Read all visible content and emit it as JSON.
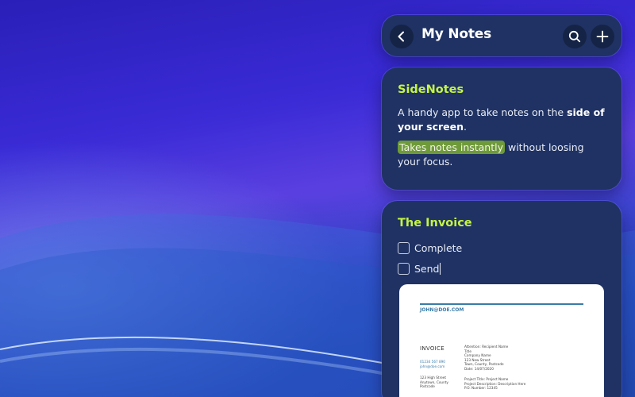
{
  "header": {
    "title": "My Notes"
  },
  "icons": {
    "back": "chevron-left-icon",
    "search": "search-icon",
    "add": "plus-icon"
  },
  "colors": {
    "card_bg": "#1f3263",
    "title_accent": "#c4f542",
    "highlight": "#6f9a3a"
  },
  "notes": [
    {
      "title": "SideNotes",
      "text_before": "A handy app to take notes on the ",
      "text_bold": "side of your screen",
      "text_after": ".",
      "highlighted": "Takes notes instantly",
      "rest": " without loosing your focus."
    },
    {
      "title": "The Invoice",
      "tasks": [
        {
          "label": "Complete",
          "checked": false
        },
        {
          "label": "Send",
          "checked": false
        }
      ],
      "attachment": {
        "email": "JOHN@DOE.COM",
        "heading": "INVOICE",
        "contact": [
          "01234 567 890",
          "john@doe.com"
        ],
        "address": [
          "123 High Street",
          "Anytown, County",
          "Postcode"
        ],
        "recipient": [
          "Attention: Recipient Name",
          "Title",
          "Company Name",
          "123 New Street",
          "Town, County, Postcode",
          "Date: 14/07/2020"
        ],
        "project": [
          "Project Title: Project Name",
          "Project Description: Description Here",
          "P.O. Number: 12345"
        ]
      }
    }
  ]
}
